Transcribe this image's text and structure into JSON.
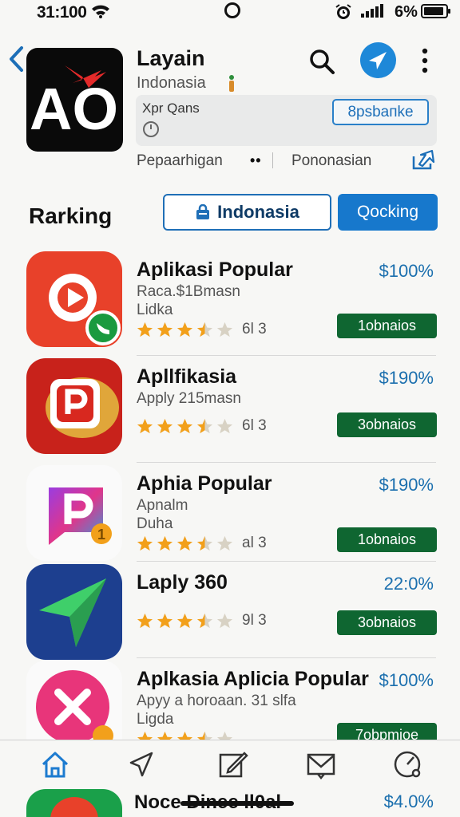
{
  "status_bar": {
    "time": "31:100",
    "battery_percent": "6%"
  },
  "app": {
    "title": "Layain",
    "subtitle": "Indonasia",
    "info_label": "Xpr Qans",
    "info_chip": "8psbaпke",
    "meta_left": "Pepaarhigan",
    "meta_dots": "••",
    "meta_right": "Pononasian",
    "icon_text": "AO"
  },
  "ranking": {
    "title": "Rarking",
    "filter_label": "Indonasia",
    "action_label": "Qocking"
  },
  "apps": [
    {
      "name": "Aplikasi Popular",
      "lines": [
        "Raca.$1Bmasn",
        "Lidka"
      ],
      "rating": 3.5,
      "rating_count": "6l 3",
      "price": "$100%",
      "badge": "1obnaios",
      "icon": "video-play-icon",
      "color": "#e8412a"
    },
    {
      "name": "Apllfikasia",
      "lines": [
        "Apply 215masn"
      ],
      "rating": 3.5,
      "rating_count": "6l 3",
      "price": "$190%",
      "badge": "3obnaios",
      "icon": "p-square-icon",
      "color": "#d8281f"
    },
    {
      "name": "Aphia Popular",
      "lines": [
        "Apnalm",
        "Duha"
      ],
      "rating": 3.5,
      "rating_count": "al 3",
      "price": "$190%",
      "badge": "1obnaios",
      "icon": "p-chat-icon",
      "color": "#ffffff"
    },
    {
      "name": "Laply 360",
      "lines": [],
      "rating": 3.5,
      "rating_count": "9l 3",
      "price": "22:0%",
      "badge": "3obnaios",
      "icon": "send-arrow-icon",
      "color": "#1d3f8f"
    },
    {
      "name": "Aplkasia Aplicia Popular",
      "lines": [
        "Apyy a horoaan. 31 slfa",
        "Ligda"
      ],
      "rating": 3.5,
      "rating_count": "",
      "price": "$100%",
      "badge": "7obpmioe",
      "icon": "x-circle-icon",
      "color": "#ffffff"
    }
  ],
  "peek_row": {
    "name": "Noce   Dinee  ll0al",
    "price": "$4.0%"
  },
  "tabs": [
    {
      "icon": "home-icon",
      "active": true
    },
    {
      "icon": "navigate-icon",
      "active": false
    },
    {
      "icon": "edit-icon",
      "active": false
    },
    {
      "icon": "mail-icon",
      "active": false
    },
    {
      "icon": "gauge-icon",
      "active": false
    }
  ],
  "colors": {
    "accent": "#1778cc",
    "badge_green": "#0f6631",
    "star": "#f2a01b",
    "price_blue": "#1b6fae"
  }
}
